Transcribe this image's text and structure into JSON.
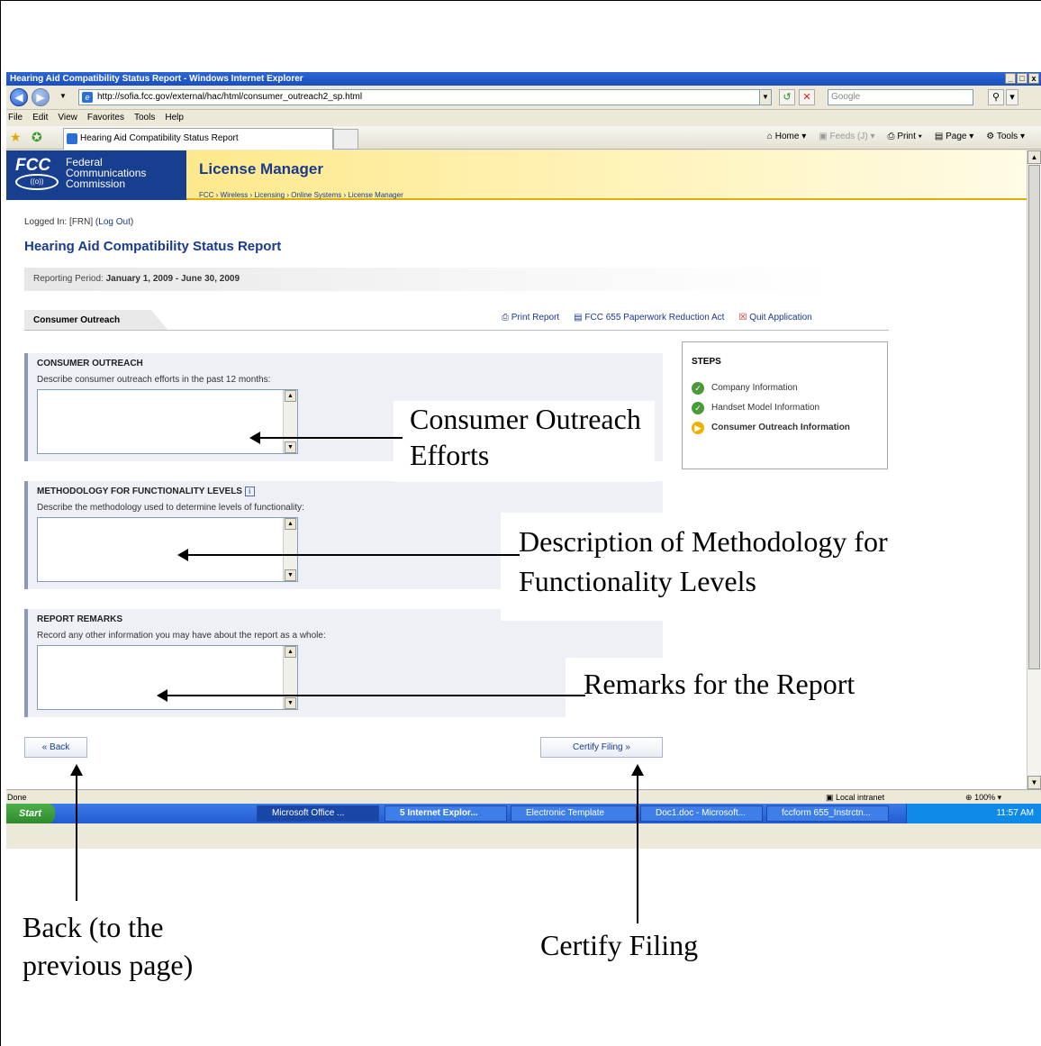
{
  "window": {
    "title": "Hearing Aid Compatibility Status Report - Windows Internet Explorer",
    "controls": [
      "_",
      "□",
      "x"
    ]
  },
  "address": {
    "url": "http://sofia.fcc.gov/external/hac/html/consumer_outreach2_sp.html",
    "search_placeholder": "Google"
  },
  "menu": [
    "File",
    "Edit",
    "View",
    "Favorites",
    "Tools",
    "Help"
  ],
  "tab": {
    "label": "Hearing Aid Compatibility Status Report"
  },
  "command_bar": {
    "home": "Home",
    "feeds": "Feeds (J)",
    "print": "Print",
    "page": "Page",
    "tools": "Tools"
  },
  "header": {
    "logo_text": "FCC",
    "org_lines": [
      "Federal",
      "Communications",
      "Commission"
    ],
    "app_title": "License Manager",
    "breadcrumb": "FCC › Wireless › Licensing › Online Systems › License Manager"
  },
  "session": {
    "logged_in_prefix": "Logged In: [FRN] (",
    "logout": "Log Out",
    "suffix": ")"
  },
  "page_title": "Hearing Aid Compatibility Status Report",
  "period": {
    "label": "Reporting Period:",
    "value": "January 1, 2009 - June 30, 2009"
  },
  "section_tab": "Consumer Outreach",
  "links": {
    "print": "Print Report",
    "paperwork": "FCC 655 Paperwork Reduction Act",
    "quit": "Quit Application"
  },
  "panels": [
    {
      "heading": "CONSUMER OUTREACH",
      "desc": "Describe consumer outreach efforts in the past 12 months:",
      "value": ""
    },
    {
      "heading": "METHODOLOGY FOR FUNCTIONALITY LEVELS",
      "desc": "Describe the methodology used to determine levels of functionality:",
      "value": ""
    },
    {
      "heading": "REPORT REMARKS",
      "desc": "Record any other information you may have about the report as a whole:",
      "value": ""
    }
  ],
  "steps": {
    "title": "STEPS",
    "items": [
      {
        "label": "Company Information",
        "state": "complete"
      },
      {
        "label": "Handset Model Information",
        "state": "complete"
      },
      {
        "label": "Consumer Outreach Information",
        "state": "current"
      }
    ]
  },
  "buttons": {
    "back": "« Back",
    "certify": "Certify Filing »"
  },
  "status": {
    "text": "Done",
    "zone": "Local intranet",
    "zoom": "100%"
  },
  "taskbar": {
    "start": "Start",
    "items": [
      "Microsoft Office ...",
      "5 Internet Explor...",
      "Electronic Template",
      "Doc1.doc - Microsoft...",
      "fccform 655_Instrctn..."
    ],
    "time": "11:57 AM"
  },
  "annotations": {
    "outreach": "Consumer Outreach Efforts",
    "methodology": "Description of Methodology for Functionality Levels",
    "remarks": "Remarks for the Report",
    "back": "Back (to the previous page)",
    "certify": "Certify Filing"
  },
  "colors": {
    "brand_blue": "#1a3a8a",
    "header_gold": "#fde47a",
    "step_green": "#4a9a3a",
    "step_current": "#f0b000"
  }
}
